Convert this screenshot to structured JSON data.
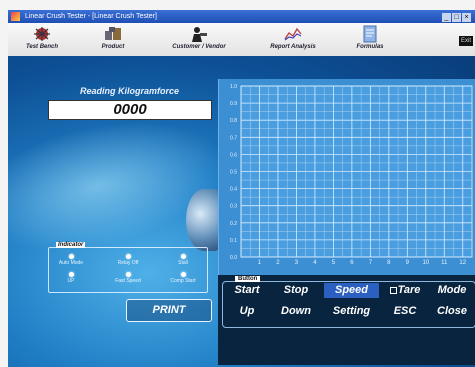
{
  "window": {
    "title": "Linear Crush Tester - [Linear Crush Tester]",
    "controls": [
      "_",
      "□",
      "×"
    ]
  },
  "toolbar": {
    "items": [
      {
        "label": "Test Bench",
        "icon": "test-bench-icon"
      },
      {
        "label": "Product",
        "icon": "product-icon"
      },
      {
        "label": "Customer / Vendor",
        "icon": "customer-icon"
      },
      {
        "label": "Report Analysis",
        "icon": "report-icon"
      },
      {
        "label": "Formulas",
        "icon": "formulas-icon"
      }
    ],
    "exit_label": "Exit"
  },
  "reading": {
    "label": "Reading Kilogramforce",
    "value": "0000"
  },
  "indicator": {
    "title": "Indicator",
    "items": [
      {
        "label": "Auto Mode"
      },
      {
        "label": "Relay Off"
      },
      {
        "label": "Stall"
      },
      {
        "label": "UP"
      },
      {
        "label": "Fast Speed"
      },
      {
        "label": "Comp Start"
      }
    ]
  },
  "chart_data": {
    "type": "line",
    "x_ticks": [
      1,
      2,
      3,
      4,
      5,
      6,
      7,
      8,
      9,
      10,
      11,
      12
    ],
    "y_ticks": [
      "1.0",
      "0.9",
      "0.8",
      "0.7",
      "0.6",
      "0.5",
      "0.4",
      "0.3",
      "0.2",
      "0.1",
      "0.0"
    ],
    "xlim": [
      0,
      12.5
    ],
    "ylim": [
      0,
      1.0
    ],
    "grid": true,
    "series": []
  },
  "buttons": {
    "title": "Button",
    "row1": [
      "Start",
      "Stop",
      "Speed",
      "Tare",
      "Mode"
    ],
    "row2": [
      "Up",
      "Down",
      "Setting",
      "ESC",
      "Close"
    ],
    "print": "PRINT"
  }
}
